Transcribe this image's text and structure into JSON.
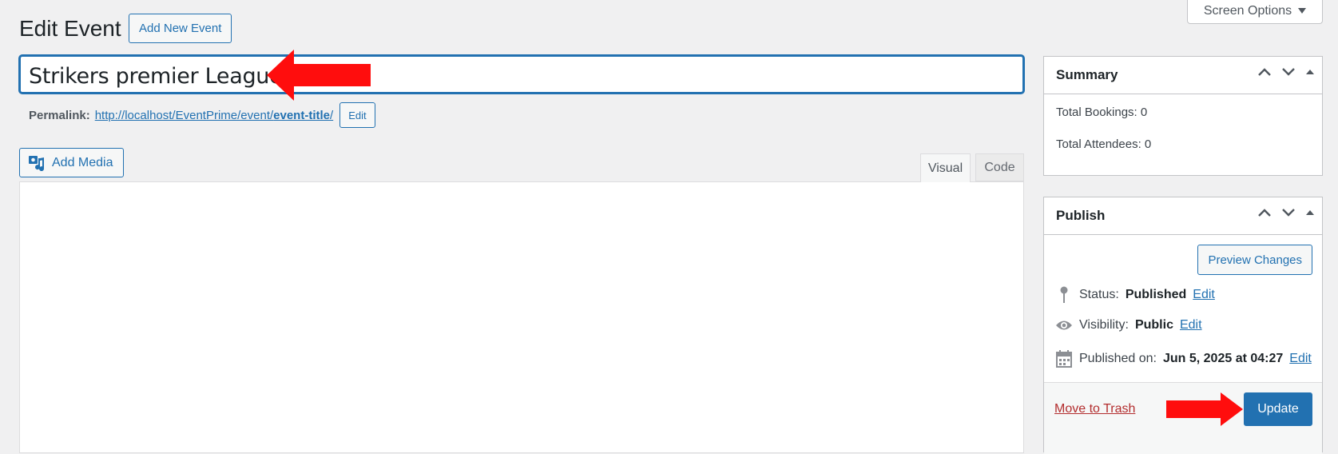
{
  "screen_options": {
    "label": "Screen Options"
  },
  "header": {
    "title": "Edit Event",
    "add_new_label": "Add New Event"
  },
  "post": {
    "title": "Strikers premier League"
  },
  "permalink": {
    "label": "Permalink:",
    "url_base": "http://localhost/EventPrime/event/",
    "slug": "event-title",
    "trailing": "/",
    "edit_label": "Edit"
  },
  "editor": {
    "add_media_label": "Add Media",
    "tabs": [
      {
        "label": "Visual",
        "active": true
      },
      {
        "label": "Code",
        "active": false
      }
    ]
  },
  "summary": {
    "title": "Summary",
    "total_bookings": "Total Bookings: 0",
    "total_attendees": "Total Attendees: 0"
  },
  "publish": {
    "title": "Publish",
    "preview_label": "Preview Changes",
    "status_label": "Status:",
    "status_value": "Published",
    "visibility_label": "Visibility:",
    "visibility_value": "Public",
    "published_label": "Published on:",
    "published_value": "Jun 5, 2025 at 04:27",
    "edit_label": "Edit",
    "trash_label": "Move to Trash",
    "update_label": "Update"
  },
  "colors": {
    "accent": "#2271b1",
    "annotation_arrow": "#ff0000",
    "trash": "#b32d2e"
  },
  "annotations": [
    "red-arrow-pointing-at-title",
    "red-arrow-pointing-at-update"
  ]
}
